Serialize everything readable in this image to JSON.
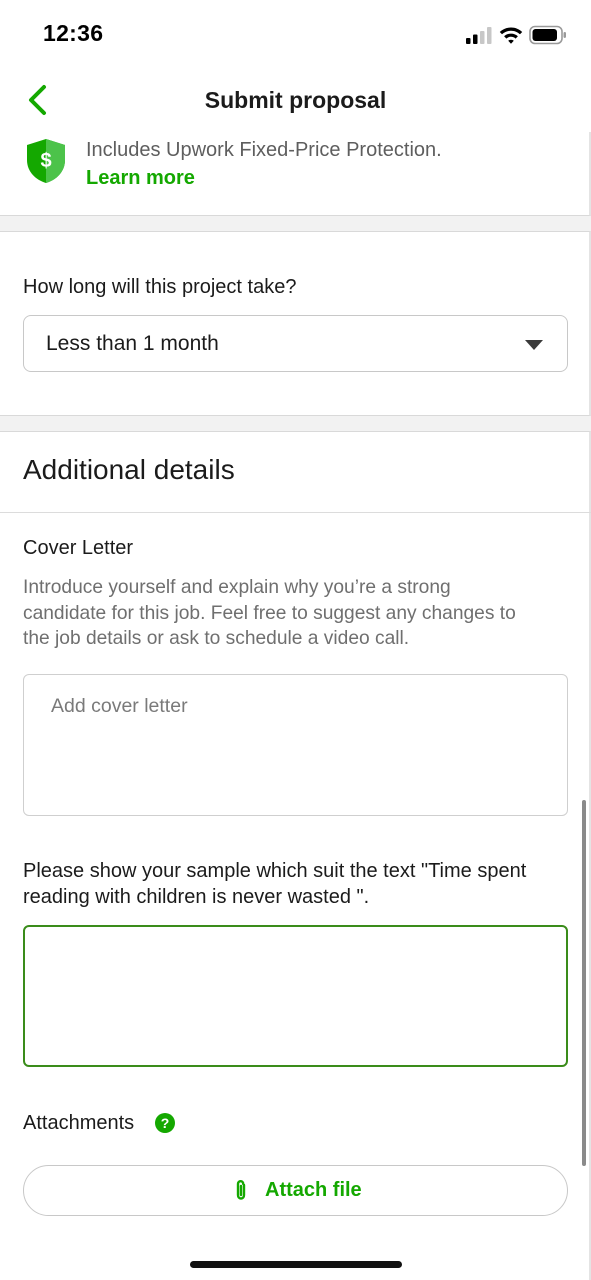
{
  "status_bar": {
    "time": "12:36"
  },
  "header": {
    "title": "Submit proposal"
  },
  "protection": {
    "text": "Includes Upwork Fixed-Price Protection.",
    "link": "Learn more"
  },
  "duration": {
    "label": "How long will this project take?",
    "selected": "Less than 1 month"
  },
  "additional": {
    "title": "Additional details",
    "cover_letter": {
      "label": "Cover Letter",
      "helper_lines": [
        "Introduce yourself and explain why you’re a strong",
        "candidate for this job. Feel free to suggest any changes to",
        "the job details or ask to schedule a video call."
      ],
      "placeholder": "Add cover letter",
      "value": ""
    },
    "question": {
      "lines": [
        "Please show your sample which suit the text \"Time spent",
        "reading with children is never wasted \"."
      ],
      "value": ""
    },
    "attachments": {
      "label": "Attachments",
      "help_glyph": "?",
      "button_label": "Attach file"
    }
  },
  "colors": {
    "brand_green": "#14a800",
    "focus_border": "#3a8c1a",
    "text_primary": "#1b1b1b",
    "text_secondary": "#6f6f6f"
  }
}
